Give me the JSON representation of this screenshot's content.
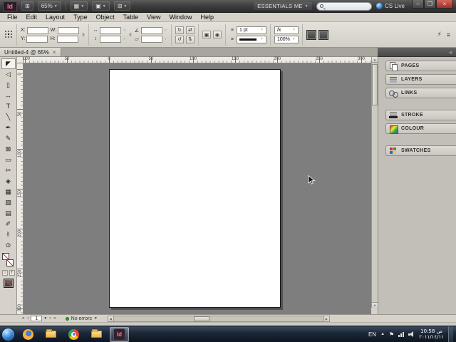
{
  "app_bar": {
    "logo_text": "Id",
    "zoom_value": "65%",
    "workspace_label": "ESSENTIALS ME",
    "cs_live_label": "CS Live",
    "search_placeholder": "",
    "window_buttons": {
      "minimize": "–",
      "restore": "❐",
      "close": "×"
    }
  },
  "icons": {
    "dropdown": "▼",
    "view_options": "▦",
    "screen_mode": "▣",
    "arrange_documents": "⊞",
    "quick_apply": "⚡",
    "panel_menu": "≡",
    "chain": "∞",
    "rotate_cw": "↻",
    "rotate_ccw": "↺",
    "flip_h": "⇄",
    "flip_v": "⇅",
    "angle": "∠",
    "shear": "▱",
    "scale_h": "↔",
    "scale_v": "↕",
    "line_style": "≡",
    "fx": "fx",
    "select_container": "▣",
    "select_content": "◉",
    "formatting_container": "□",
    "formatting_text": "T",
    "left_arrow": "◀",
    "right_arrow": "▶",
    "up_arrow": "▲",
    "down_arrow": "▼",
    "expand_dock": "«",
    "flag": "⚑"
  },
  "menu_bar": {
    "items": [
      "File",
      "Edit",
      "Layout",
      "Type",
      "Object",
      "Table",
      "View",
      "Window",
      "Help"
    ]
  },
  "control_panel": {
    "x_label": "X:",
    "y_label": "Y:",
    "w_label": "W:",
    "h_label": "H:",
    "x_value": "",
    "y_value": "",
    "w_value": "",
    "h_value": "",
    "scale_x_value": "",
    "scale_y_value": "",
    "rotation_value": "",
    "shear_value": "",
    "stroke_weight_value": "1 pt",
    "tint_value": "100%"
  },
  "document_tab": {
    "title": "Untitled-4 @ 65%",
    "close_glyph": "×"
  },
  "rulers": {
    "horizontal": [
      "100",
      "50",
      "0",
      "50",
      "100",
      "150",
      "200",
      "250",
      "300"
    ],
    "vertical": [
      "0",
      "50",
      "100",
      "150",
      "200",
      "250",
      "300"
    ]
  },
  "tools": [
    {
      "name": "selection-tool",
      "glyph": "◤"
    },
    {
      "name": "direct-selection-tool",
      "glyph": "◁"
    },
    {
      "name": "page-tool",
      "glyph": "▯"
    },
    {
      "name": "gap-tool",
      "glyph": "↔"
    },
    {
      "name": "type-tool",
      "glyph": "T"
    },
    {
      "name": "line-tool",
      "glyph": "╲"
    },
    {
      "name": "pen-tool",
      "glyph": "✒"
    },
    {
      "name": "pencil-tool",
      "glyph": "✎"
    },
    {
      "name": "rectangle-frame-tool",
      "glyph": "⊠"
    },
    {
      "name": "rectangle-tool",
      "glyph": "▭"
    },
    {
      "name": "scissors-tool",
      "glyph": "✂"
    },
    {
      "name": "free-transform-tool",
      "glyph": "◈"
    },
    {
      "name": "gradient-swatch-tool",
      "glyph": "▦"
    },
    {
      "name": "gradient-feather-tool",
      "glyph": "▨"
    },
    {
      "name": "note-tool",
      "glyph": "▤"
    },
    {
      "name": "eyedropper-tool",
      "glyph": "✐"
    },
    {
      "name": "hand-tool",
      "glyph": "✌"
    },
    {
      "name": "zoom-tool",
      "glyph": "⊙"
    }
  ],
  "panel_dock": {
    "groups": [
      {
        "items": [
          {
            "label": "PAGES"
          },
          {
            "label": "LAYERS"
          },
          {
            "label": "LINKS"
          }
        ]
      },
      {
        "items": [
          {
            "label": "STROKE"
          },
          {
            "label": "COLOUR"
          }
        ]
      },
      {
        "items": [
          {
            "label": "SWATCHES"
          }
        ]
      }
    ]
  },
  "status_bar": {
    "first_page": "«",
    "prev_page": "‹",
    "page_number": "1",
    "next_page": "›",
    "last_page": "»",
    "errors_label": "No errors"
  },
  "taskbar": {
    "language": "EN",
    "tray_expand": "▲",
    "time": "10:58 ص",
    "date": "٢٠١١/١٤/١١"
  },
  "colors": {
    "indesign_brand_pink": "#ff6ea6",
    "cs_live_blue": "#3aa0e8",
    "no_errors_green": "#35a135",
    "close_button_red": "#c0463c",
    "pasteboard_gray": "#7e7e7e",
    "panel_chrome_gray": "#d6d2ca"
  }
}
